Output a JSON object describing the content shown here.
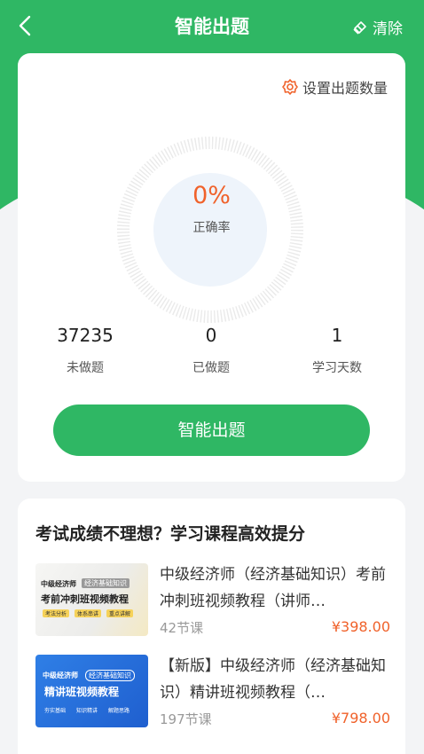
{
  "header": {
    "title": "智能出题",
    "clear_label": "清除"
  },
  "settings": {
    "label": "设置出题数量"
  },
  "progress": {
    "rate": "0%",
    "rate_label": "正确率"
  },
  "stats": [
    {
      "value": "37235",
      "label": "未做题"
    },
    {
      "value": "0",
      "label": "已做题"
    },
    {
      "value": "1",
      "label": "学习天数"
    }
  ],
  "action": {
    "button_label": "智能出题"
  },
  "recommend": {
    "title": "考试成绩不理想？学习课程高效提分",
    "courses": [
      {
        "title": "中级经济师（经济基础知识）考前冲刺班视频教程（讲师…",
        "lessons": "42节课",
        "price": "¥398.00",
        "thumb": {
          "brand": "中级经济师",
          "tag": "经济基础知识",
          "main": "考前冲刺班视频教程",
          "chips": [
            "考法分析",
            "体系串讲",
            "重点讲解"
          ]
        }
      },
      {
        "title": "【新版】中级经济师（经济基础知识）精讲班视频教程（…",
        "lessons": "197节课",
        "price": "¥798.00",
        "thumb": {
          "brand": "中级经济师",
          "tag": "经济基础知识",
          "main": "精讲班视频教程",
          "chips": [
            "夯实基础",
            "知识精讲",
            "解题思路"
          ]
        }
      }
    ]
  },
  "colors": {
    "primary": "#2fb764",
    "accent": "#f0622b",
    "background": "#f3f4f6"
  }
}
